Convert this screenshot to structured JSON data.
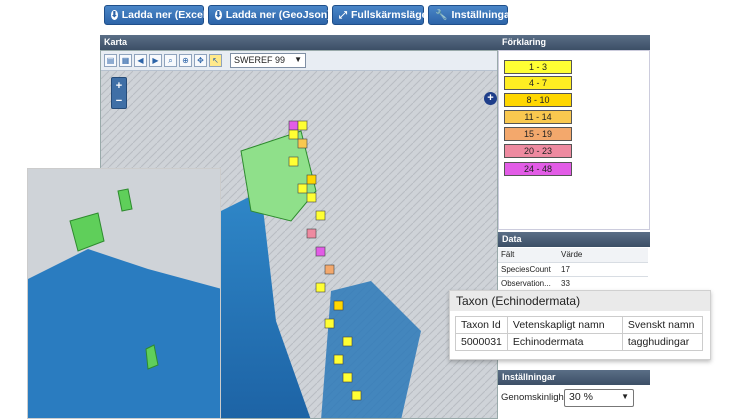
{
  "toolbar": {
    "excel_label": "Ladda ner (Excel)",
    "geojson_label": "Ladda ner (GeoJson)",
    "fullscreen_label": "Fullskärmsläge",
    "settings_label": "Inställningar"
  },
  "map": {
    "title": "Karta",
    "projection": "SWEREF 99",
    "zoom_in": "+",
    "zoom_out": "−"
  },
  "legend": {
    "title": "Förklaring",
    "items": [
      {
        "label": "1 - 3",
        "color": "#ffff33"
      },
      {
        "label": "4 - 7",
        "color": "#ffee22"
      },
      {
        "label": "8 - 10",
        "color": "#ffd700"
      },
      {
        "label": "11 - 14",
        "color": "#f9c84f"
      },
      {
        "label": "15 - 19",
        "color": "#f3a86c"
      },
      {
        "label": "20 - 23",
        "color": "#ee8aa0"
      },
      {
        "label": "24 - 48",
        "color": "#e25ce6"
      }
    ]
  },
  "data_panel": {
    "title": "Data",
    "col_field": "Fält",
    "col_value": "Värde",
    "rows": [
      {
        "field": "SpeciesCount",
        "value": "17"
      },
      {
        "field": "Observation...",
        "value": "33"
      }
    ]
  },
  "popup": {
    "title": "Taxon (Echinodermata)",
    "headers": [
      "Taxon Id",
      "Vetenskapligt namn",
      "Svenskt namn"
    ],
    "row": [
      "5000031",
      "Echinodermata",
      "tagghudingar"
    ]
  },
  "settings": {
    "title": "Inställningar",
    "opacity_label": "Genomskinlighet",
    "opacity_value": "30 %"
  }
}
